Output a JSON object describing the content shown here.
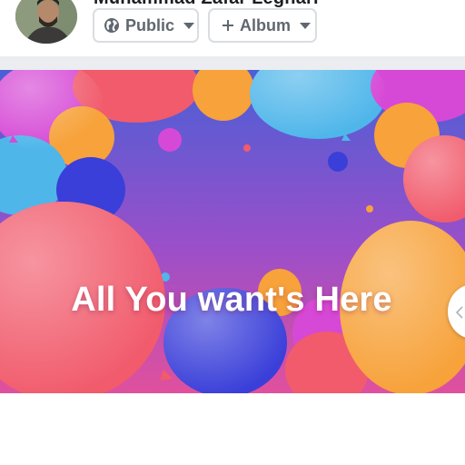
{
  "header": {
    "user_name": "Muhammad Zafar Leghari",
    "avatar_icon": "profile-photo",
    "privacy_button": {
      "label": "Public",
      "icon": "globe-icon"
    },
    "album_button": {
      "label": "Album",
      "icon": "plus-icon"
    }
  },
  "banner": {
    "text": "All You want's Here",
    "background_gradient": [
      "#4a5fd6",
      "#d44aa8"
    ],
    "balloon_colors": [
      "#ff5e7e",
      "#f7a23a",
      "#3a3fd9",
      "#4fb6ea",
      "#d649d6",
      "#f15b6c"
    ]
  },
  "carousel": {
    "next_icon": "chevron-left-icon"
  }
}
